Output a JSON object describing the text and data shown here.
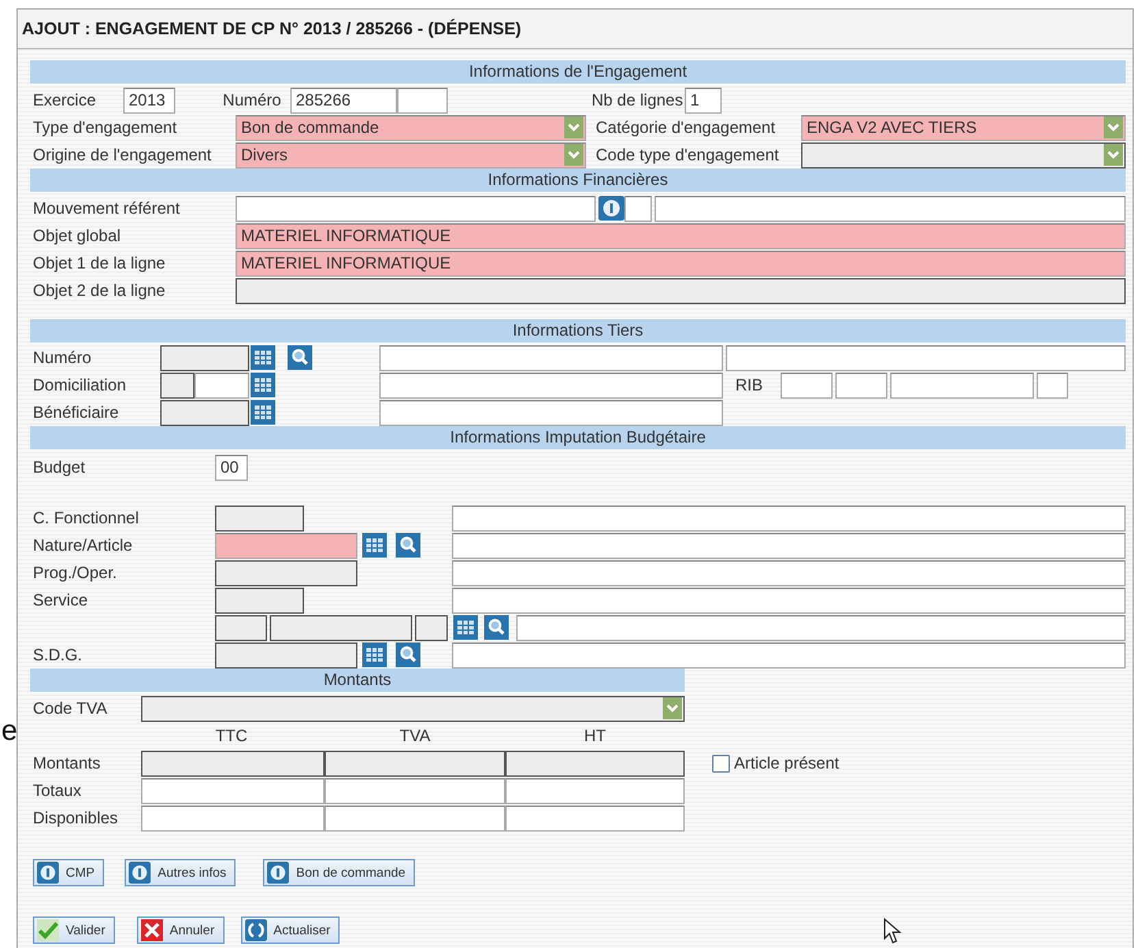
{
  "window": {
    "title": "AJOUT : ENGAGEMENT DE CP N° 2013 / 285266 - (DÉPENSE)"
  },
  "backdrop_text": "e",
  "sections": [
    {
      "title": "Informations de l'Engagement",
      "rows": [
        {
          "items": [
            {
              "kind": "label",
              "text": "Exercice"
            },
            {
              "kind": "input",
              "value": "2013",
              "required": false,
              "readonly": false
            },
            {
              "kind": "label",
              "text": "Numéro"
            },
            {
              "kind": "input",
              "value": "285266",
              "required": false,
              "readonly": false
            },
            {
              "kind": "input",
              "required": false,
              "readonly": false
            },
            {
              "kind": "label",
              "text": "Nb de lignes"
            },
            {
              "kind": "input",
              "value": "1",
              "required": false,
              "readonly": false
            }
          ]
        },
        {
          "items": [
            {
              "kind": "label",
              "text": "Type d'engagement"
            },
            {
              "kind": "select",
              "value": "Bon de commande",
              "required": true,
              "readonly": false
            },
            {
              "kind": "label",
              "text": "Catégorie d'engagement"
            },
            {
              "kind": "select",
              "value": "ENGA V2 AVEC TIERS",
              "required": true,
              "readonly": false
            }
          ]
        },
        {
          "items": [
            {
              "kind": "label",
              "text": "Origine de l'engagement"
            },
            {
              "kind": "select",
              "value": "Divers",
              "required": true,
              "readonly": false
            },
            {
              "kind": "label",
              "text": "Code type d'engagement"
            },
            {
              "kind": "select",
              "required": false,
              "readonly": true
            }
          ]
        }
      ]
    },
    {
      "title": "Informations Financières",
      "rows": [
        {
          "items": [
            {
              "kind": "label",
              "text": "Mouvement référent"
            },
            {
              "kind": "input",
              "required": false,
              "readonly": false
            },
            {
              "kind": "info"
            },
            {
              "kind": "input",
              "required": false,
              "readonly": false
            },
            {
              "kind": "input",
              "required": false,
              "readonly": false
            }
          ]
        },
        {
          "items": [
            {
              "kind": "label",
              "text": "Objet global"
            },
            {
              "kind": "input",
              "value": "MATERIEL INFORMATIQUE",
              "required": true,
              "readonly": false
            }
          ]
        },
        {
          "items": [
            {
              "kind": "label",
              "text": "Objet 1 de la ligne"
            },
            {
              "kind": "input",
              "value": "MATERIEL INFORMATIQUE",
              "required": true,
              "readonly": false
            }
          ]
        },
        {
          "items": [
            {
              "kind": "label",
              "text": "Objet 2 de la ligne"
            },
            {
              "kind": "input",
              "required": false,
              "readonly": true
            }
          ]
        }
      ]
    },
    {
      "title": "Informations Tiers",
      "rows": [
        {
          "items": [
            {
              "kind": "label",
              "text": "Numéro"
            },
            {
              "kind": "input",
              "required": false,
              "readonly": true
            },
            {
              "kind": "grid"
            },
            {
              "kind": "search"
            },
            {
              "kind": "input",
              "required": false,
              "readonly": false
            },
            {
              "kind": "input",
              "required": false,
              "readonly": false
            }
          ]
        },
        {
          "items": [
            {
              "kind": "label",
              "text": "Domiciliation"
            },
            {
              "kind": "input",
              "required": false,
              "readonly": true
            },
            {
              "kind": "input",
              "required": false,
              "readonly": false
            },
            {
              "kind": "grid"
            },
            {
              "kind": "input",
              "required": false,
              "readonly": false
            },
            {
              "kind": "label",
              "text": "RIB"
            },
            {
              "kind": "input",
              "required": false,
              "readonly": false
            },
            {
              "kind": "input",
              "required": false,
              "readonly": false
            },
            {
              "kind": "input",
              "required": false,
              "readonly": false
            },
            {
              "kind": "input",
              "required": false,
              "readonly": false
            }
          ]
        },
        {
          "items": [
            {
              "kind": "label",
              "text": "Bénéficiaire"
            },
            {
              "kind": "input",
              "required": false,
              "readonly": true
            },
            {
              "kind": "grid"
            },
            {
              "kind": "input",
              "required": false,
              "readonly": false
            }
          ]
        }
      ]
    },
    {
      "title": "Informations Imputation Budgétaire",
      "rows": [
        {
          "items": [
            {
              "kind": "label",
              "text": "Budget"
            },
            {
              "kind": "input",
              "value": "00",
              "required": false,
              "readonly": false
            }
          ]
        },
        {
          "items": [
            {
              "kind": "label",
              "text": "C. Fonctionnel"
            },
            {
              "kind": "input",
              "required": false,
              "readonly": true
            },
            {
              "kind": "input",
              "required": false,
              "readonly": false
            }
          ]
        },
        {
          "items": [
            {
              "kind": "label",
              "text": "Nature/Article"
            },
            {
              "kind": "input",
              "required": true,
              "readonly": false
            },
            {
              "kind": "grid"
            },
            {
              "kind": "search"
            },
            {
              "kind": "input",
              "required": false,
              "readonly": false
            }
          ]
        },
        {
          "items": [
            {
              "kind": "label",
              "text": "Prog./Oper."
            },
            {
              "kind": "input",
              "required": false,
              "readonly": true
            },
            {
              "kind": "input",
              "required": false,
              "readonly": false
            }
          ]
        },
        {
          "items": [
            {
              "kind": "label",
              "text": "Service"
            },
            {
              "kind": "input",
              "required": false,
              "readonly": true
            },
            {
              "kind": "input",
              "required": false,
              "readonly": false
            }
          ]
        },
        {
          "items": [
            {
              "kind": "input",
              "required": false,
              "readonly": true
            },
            {
              "kind": "input",
              "required": false,
              "readonly": true
            },
            {
              "kind": "input",
              "required": false,
              "readonly": true
            },
            {
              "kind": "grid"
            },
            {
              "kind": "search"
            },
            {
              "kind": "input",
              "required": false,
              "readonly": false
            }
          ]
        },
        {
          "items": [
            {
              "kind": "label",
              "text": "S.D.G."
            },
            {
              "kind": "input",
              "required": false,
              "readonly": true
            },
            {
              "kind": "grid"
            },
            {
              "kind": "search"
            },
            {
              "kind": "input",
              "required": false,
              "readonly": false
            }
          ]
        }
      ]
    },
    {
      "title": "Montants",
      "rows": [
        {
          "items": [
            {
              "kind": "label",
              "text": "Code TVA"
            },
            {
              "kind": "select",
              "required": false,
              "readonly": true
            }
          ]
        },
        {
          "items": [
            {
              "kind": "label",
              "text": "TTC"
            },
            {
              "kind": "label",
              "text": "TVA"
            },
            {
              "kind": "label",
              "text": "HT"
            }
          ]
        },
        {
          "items": [
            {
              "kind": "label",
              "text": "Montants"
            },
            {
              "kind": "input",
              "required": false,
              "readonly": true
            },
            {
              "kind": "input",
              "required": false,
              "readonly": true
            },
            {
              "kind": "input",
              "required": false,
              "readonly": true
            },
            {
              "kind": "checkbox",
              "text": "Article présent",
              "checked": false
            }
          ]
        },
        {
          "items": [
            {
              "kind": "label",
              "text": "Totaux"
            },
            {
              "kind": "input",
              "required": false,
              "readonly": false
            },
            {
              "kind": "input",
              "required": false,
              "readonly": false
            },
            {
              "kind": "input",
              "required": false,
              "readonly": false
            }
          ]
        },
        {
          "items": [
            {
              "kind": "label",
              "text": "Disponibles"
            },
            {
              "kind": "input",
              "required": false,
              "readonly": false
            },
            {
              "kind": "input",
              "required": false,
              "readonly": false
            },
            {
              "kind": "input",
              "required": false,
              "readonly": false
            }
          ]
        }
      ]
    }
  ],
  "info_buttons": [
    "CMP",
    "Autres infos",
    "Bon de commande"
  ],
  "action_buttons": [
    "Valider",
    "Annuler",
    "Actualiser"
  ]
}
